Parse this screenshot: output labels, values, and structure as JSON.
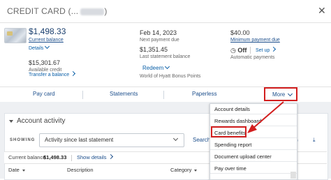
{
  "header": {
    "title": "CREDIT CARD (...",
    "title_tail": ")"
  },
  "summary": {
    "current_balance": {
      "value": "$1,498.33",
      "label": "Current balance",
      "details_link": "Details"
    },
    "available_credit": {
      "value": "$15,301.67",
      "label": "Available credit",
      "transfer_link": "Transfer a balance"
    },
    "due_date": {
      "value": "Feb 14, 2023",
      "label": "Next payment due"
    },
    "statement_balance": {
      "value": "$1,351.45",
      "label": "Last statement balance"
    },
    "redeem": {
      "label": "Redeem",
      "sub": "World of Hyatt Bonus Points"
    },
    "min_payment": {
      "value": "$40.00",
      "label": "Minimum payment due"
    },
    "autopay": {
      "status": "Off",
      "setup_link": "Set up",
      "label": "Automatic payments"
    }
  },
  "actions": {
    "pay": "Pay card",
    "statements": "Statements",
    "paperless": "Paperless",
    "more": "More"
  },
  "menu": {
    "items": [
      "Account details",
      "Rewards dashboard",
      "Card benefits",
      "Spending report",
      "Document upload center",
      "Pay over time"
    ]
  },
  "activity": {
    "title": "Account activity",
    "showing_label": "SHOWING",
    "selected": "Activity since last statement",
    "search": "Search",
    "current_balance_label": "Current balance",
    "current_balance_value": "$1,498.33",
    "show_details": "Show details",
    "columns": {
      "date": "Date",
      "description": "Description",
      "category": "Category"
    }
  },
  "colors": {
    "accent": "#1d4f8c",
    "highlight": "#d21e1e"
  }
}
